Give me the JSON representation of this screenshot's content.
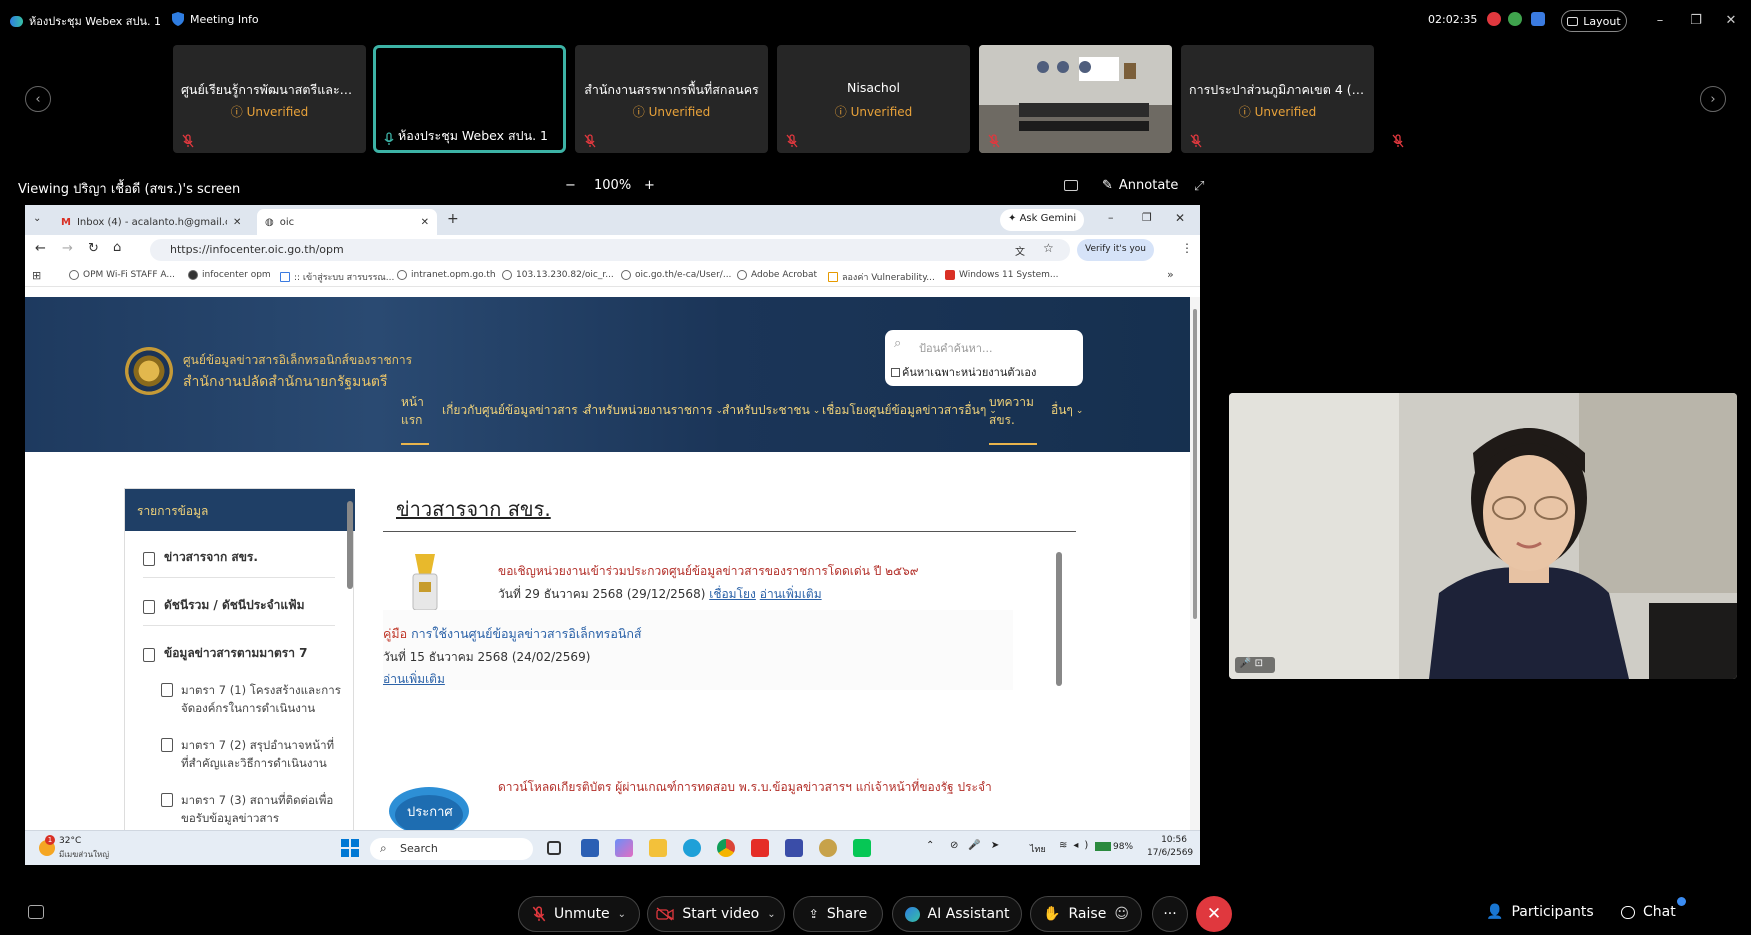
{
  "topbar": {
    "app_title": "ห้องประชุม Webex สปน. 1",
    "meeting_info": "Meeting Info",
    "time": "02:02:35",
    "layout_label": "Layout",
    "colors": {
      "record": "#e0383e",
      "green": "#3fa34d",
      "blue": "#3b7be0"
    }
  },
  "participants": [
    {
      "name": "ศูนย์เรียนรู้การพัฒนาสตรีและค...",
      "status": "Unverified"
    },
    {
      "name": "ห้องประชุม Webex สปน. 1",
      "status": ""
    },
    {
      "name": "สำนักงานสรรพากรพื้นที่สกลนคร",
      "status": "Unverified"
    },
    {
      "name": "Nisachol",
      "status": "Unverified"
    },
    {
      "name": "",
      "status": ""
    },
    {
      "name": "การประปาส่วนภูมิภาคเขต 4 (บ้...",
      "status": "Unverified"
    },
    {
      "name": "",
      "status": ""
    }
  ],
  "share": {
    "viewing_label": "Viewing ปริญา เชื้อดี (สขร.)'s screen",
    "zoom": "100%",
    "annotate": "Annotate"
  },
  "browser": {
    "tabs": [
      "Inbox (4) - acalanto.h@gmail.co",
      "oic"
    ],
    "gemini": "Ask Gemini",
    "url": "https://infocenter.oic.go.th/opm",
    "verify": "Verify it's you",
    "bookmarks": [
      "OPM Wi-Fi STAFF A...",
      "infocenter opm",
      ":: เข้าสู่ระบบ สารบรรณ...",
      "intranet.opm.go.th",
      "103.13.230.82/oic_r...",
      "oic.go.th/e-ca/User/...",
      "Adobe Acrobat",
      "ลองค่า Vulnerability...",
      "Windows 11 System..."
    ]
  },
  "site": {
    "org_line1": "ศูนย์ข้อมูลข่าวสารอิเล็กทรอนิกส์ของราชการ",
    "org_line2": "สำนักงานปลัดสำนักนายกรัฐมนตรี",
    "search_placeholder": "ป้อนคำค้นหา...",
    "search_checkbox": "ค้นหาเฉพาะหน่วยงานตัวเอง",
    "menu": [
      "หน้าแรก",
      "เกี่ยวกับศูนย์ข้อมูลข่าวสาร",
      "สำหรับหน่วยงานราชการ",
      "สำหรับประชาชน",
      "เชื่อมโยงศูนย์ข้อมูลข่าวสารอื่นๆ",
      "บทความสขร.",
      "อื่นๆ"
    ],
    "menu_home_1": "หน้า",
    "menu_home_2": "แรก",
    "menu_article_1": "บทความ",
    "menu_article_2": "สขร.",
    "sidebar_title": "รายการข้อมูล",
    "sidebar_items": [
      "ข่าวสารจาก สขร.",
      "ดัชนีรวม / ดัชนีประจำแฟ้ม",
      "ข้อมูลข่าวสารตามมาตรา 7"
    ],
    "sidebar_subs": [
      "มาตรา 7 (1) โครงสร้างและการจัดองค์กรในการดำเนินงาน",
      "มาตรา 7 (2) สรุปอำนาจหน้าที่ที่สำคัญและวิธีการดำเนินงาน",
      "มาตรา 7 (3) สถานที่ติดต่อเพื่อขอรับข้อมูลข่าวสาร"
    ],
    "news_title": "ข่าวสารจาก สขร.",
    "news": [
      {
        "title": "ขอเชิญหน่วยงานเข้าร่วมประกวดศูนย์ข้อมูลข่าวสารของราชการโดดเด่น ปี ๒๕๖๙",
        "date": "วันที่ 29 ธันวาคม 2568 (29/12/2568)",
        "link1": "เชื่อมโยง",
        "link2": "อ่านเพิ่มเติม"
      },
      {
        "prefix": "คู่มือ",
        "title": "การใช้งานศูนย์ข้อมูลข่าวสารอิเล็กทรอนิกส์",
        "date": "วันที่ 15 ธันวาคม 2568 (24/02/2569)",
        "link2": "อ่านเพิ่มเติม"
      },
      {
        "title": "ดาวน์โหลดเกียรติบัตร ผู้ผ่านเกณฑ์การทดสอบ พ.ร.บ.ข้อมูลข่าวสารฯ แก่เจ้าหน้าที่ของรัฐ ประจำ",
        "badge": "ประกาศ"
      }
    ]
  },
  "taskbar": {
    "weather_temp": "32°C",
    "weather_desc": "มีเมฆส่วนใหญ่",
    "weather_badge": "1",
    "search": "Search",
    "lang": "ไทย",
    "battery": "98%",
    "clock_time": "10:56",
    "clock_date": "17/6/2569"
  },
  "controls": {
    "unmute": "Unmute",
    "start_video": "Start video",
    "share": "Share",
    "ai_assistant": "AI Assistant",
    "raise": "Raise",
    "participants": "Participants",
    "chat": "Chat"
  }
}
